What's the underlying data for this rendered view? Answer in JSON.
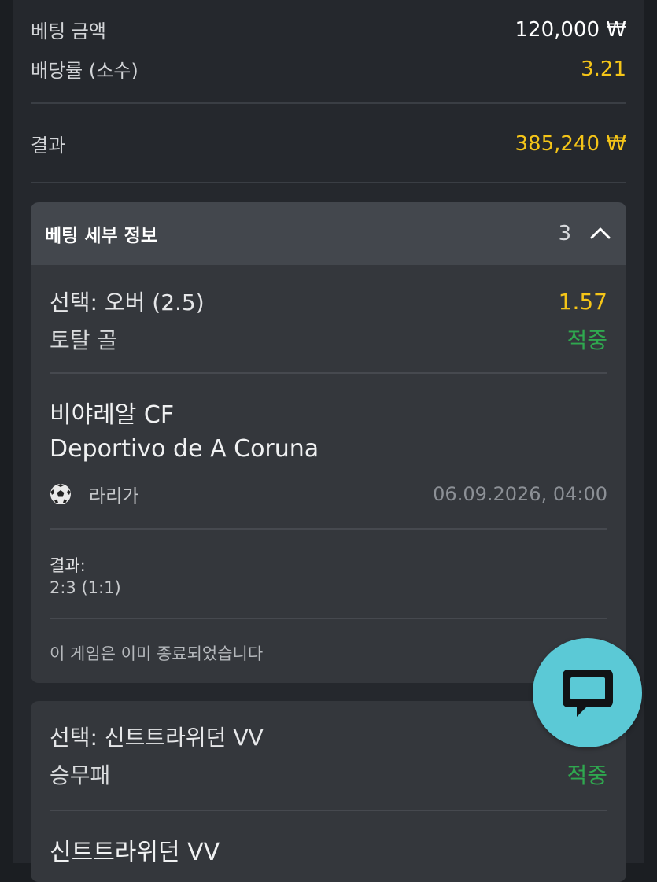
{
  "summary": {
    "stake_label": "베팅 금액",
    "stake_value": "120,000 ₩",
    "odds_label": "배당률 (소수)",
    "odds_value": "3.21",
    "result_label": "결과",
    "result_value": "385,240 ₩"
  },
  "details": {
    "title": "베팅 세부 정보",
    "count": "3",
    "expanded": true
  },
  "selections": [
    {
      "selection": "선택: 오버 (2.5)",
      "odds": "1.57",
      "market": "토탈 골",
      "status": "적중",
      "home_team": "비야레알 CF",
      "away_team": "Deportivo de A Coruna",
      "sport_icon": "soccer-ball-icon",
      "league": "라리가",
      "datetime": "06.09.2026, 04:00",
      "result_label": "결과:",
      "result_score": "2:3 (1:1)",
      "note": "이 게임은 이미 종료되었습니다"
    },
    {
      "selection": "선택: 신트트라위던 VV",
      "market": "승무패",
      "status": "적중",
      "home_team": "신트트라위던 VV"
    }
  ],
  "chat_button": {
    "icon": "chat-bubble-icon"
  },
  "colors": {
    "accent_yellow": "#f5c518",
    "win_green": "#2fa84f",
    "chat_teal": "#5bc9d6"
  }
}
